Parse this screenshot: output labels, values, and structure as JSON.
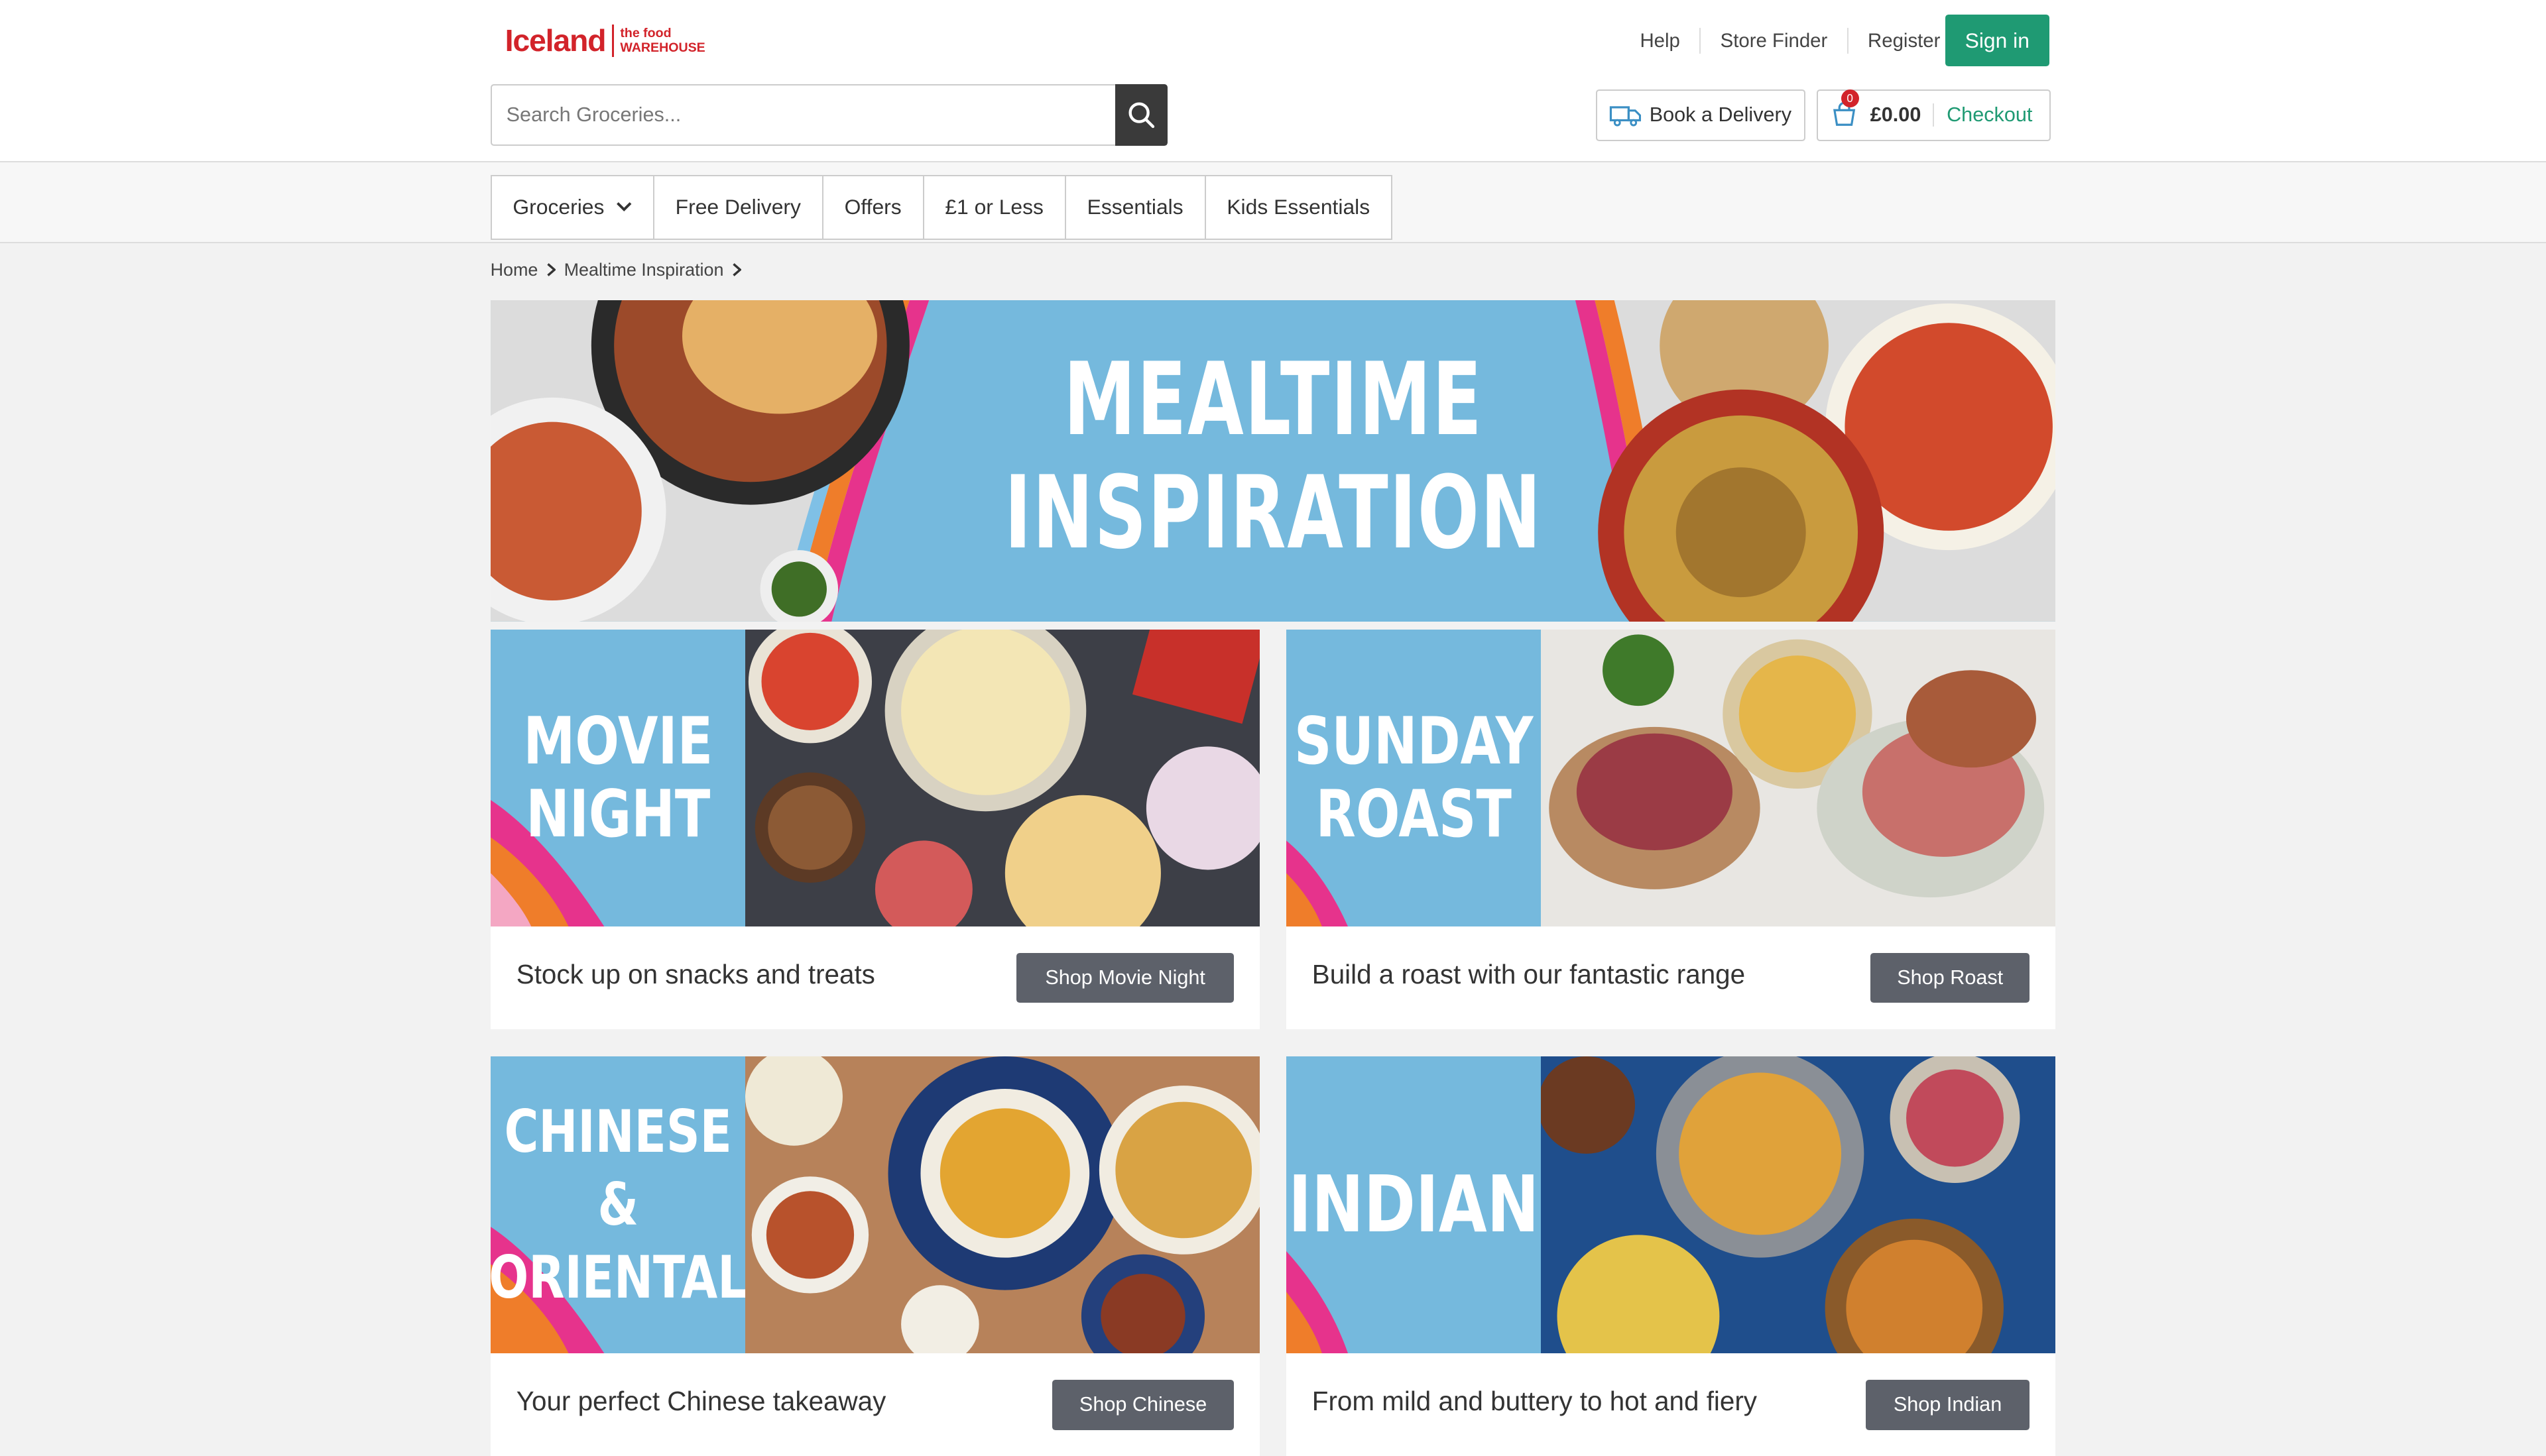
{
  "header": {
    "logo": {
      "brand": "Iceland",
      "sub_line1": "the food",
      "sub_line2": "WAREHOUSE"
    },
    "top_links": [
      "Help",
      "Store Finder",
      "Register"
    ],
    "sign_in": "Sign in",
    "search": {
      "placeholder": "Search Groceries..."
    },
    "delivery": "Book a Delivery",
    "basket": {
      "count": "0",
      "total": "£0.00",
      "checkout": "Checkout"
    }
  },
  "nav": {
    "items": [
      "Groceries",
      "Free Delivery",
      "Offers",
      "£1 or Less",
      "Essentials",
      "Kids Essentials"
    ]
  },
  "breadcrumb": [
    "Home",
    "Mealtime Inspiration"
  ],
  "hero": {
    "line1": "MEALTIME",
    "line2": "INSPIRATION"
  },
  "cards": [
    {
      "line1": "MOVIE",
      "line2": "NIGHT",
      "desc": "Stock up on snacks and treats",
      "button": "Shop Movie Night"
    },
    {
      "line1": "SUNDAY",
      "line2": "ROAST",
      "desc": "Build a roast with our fantastic range",
      "button": "Shop Roast"
    },
    {
      "line1": "CHINESE &",
      "line2": "ORIENTAL",
      "desc": "Your perfect Chinese takeaway",
      "button": "Shop Chinese"
    },
    {
      "line1": "INDIAN",
      "line2": "",
      "desc": "From mild and buttery to hot and fiery",
      "button": "Shop Indian"
    }
  ],
  "colors": {
    "brand_red": "#d2232a",
    "accent_green": "#1f9a73",
    "banner_blue": "#75b9dd",
    "button_grey": "#5d616a"
  }
}
